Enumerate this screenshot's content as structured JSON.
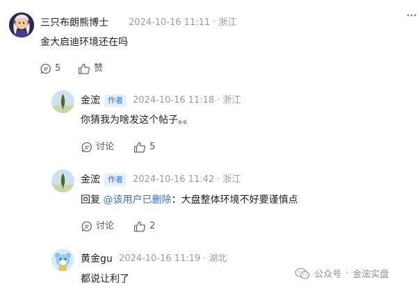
{
  "comments": [
    {
      "author": "三只布朗熊博士",
      "date": "2024-10-16 11:11",
      "separator": "·",
      "location": "浙江",
      "text": "金大启迪环境还在吗",
      "reply_count": "5",
      "like_label": "赞",
      "avatar_icon": "girl-portrait-avatar"
    },
    {
      "author": "金浤",
      "badge": "作者",
      "date": "2024-10-16 11:18",
      "separator": "·",
      "location": "浙江",
      "text": "你猜我为啥发这个帖子。。",
      "reply_label": "讨论",
      "like_count": "5",
      "avatar_icon": "tree-landscape-avatar"
    },
    {
      "author": "金浤",
      "badge": "作者",
      "date": "2024-10-16 11:42",
      "separator": "·",
      "location": "浙江",
      "text_prefix": "回复 ",
      "mention": "@该用户已删除",
      "text_suffix": "：大盘整体环境不好要谨慎点",
      "reply_label": "讨论",
      "like_count": "2",
      "avatar_icon": "tree-landscape-avatar"
    },
    {
      "author": "黄金gu",
      "date": "2024-10-16 11:19",
      "separator": "·",
      "location": "湖北",
      "text": "都说让利了",
      "avatar_icon": "cartoon-bear-avatar"
    }
  ],
  "watermark": {
    "account": "公众号",
    "separator": "·",
    "name": "金浤实盘",
    "icon": "wechat-icon"
  },
  "colors": {
    "badge_text": "#2f6fd6",
    "badge_bg": "#e6efff",
    "mention": "#3b6cc8",
    "meta": "#9a9a9a"
  }
}
